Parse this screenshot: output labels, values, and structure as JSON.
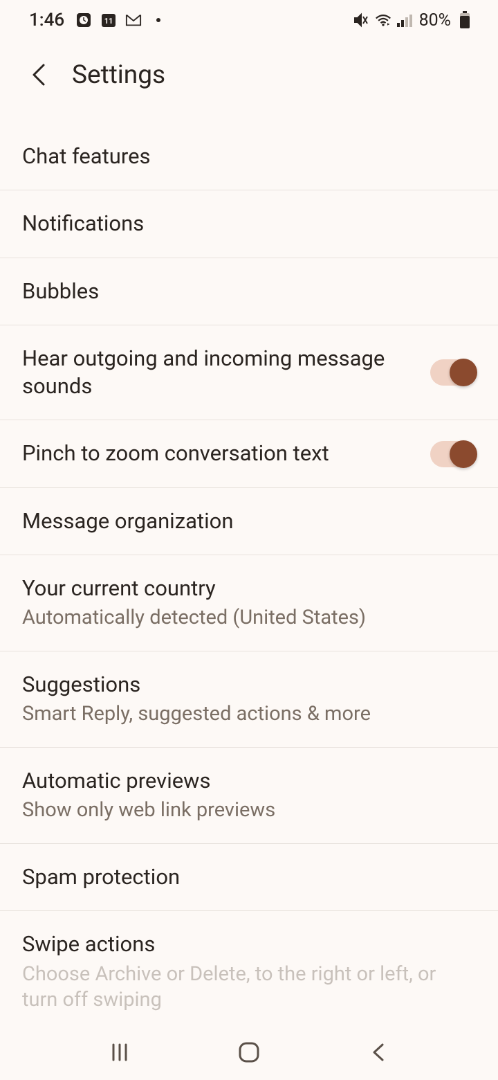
{
  "status": {
    "time": "1:46",
    "battery": "80%"
  },
  "header": {
    "title": "Settings"
  },
  "settings": {
    "items": [
      {
        "title": "Chat features",
        "subtitle": null,
        "toggle": null
      },
      {
        "title": "Notifications",
        "subtitle": null,
        "toggle": null
      },
      {
        "title": "Bubbles",
        "subtitle": null,
        "toggle": null
      },
      {
        "title": "Hear outgoing and incoming message sounds",
        "subtitle": null,
        "toggle": true
      },
      {
        "title": "Pinch to zoom conversation text",
        "subtitle": null,
        "toggle": true
      },
      {
        "title": "Message organization",
        "subtitle": null,
        "toggle": null
      },
      {
        "title": "Your current country",
        "subtitle": "Automatically detected (United States)",
        "toggle": null
      },
      {
        "title": "Suggestions",
        "subtitle": "Smart Reply, suggested actions & more",
        "toggle": null
      },
      {
        "title": "Automatic previews",
        "subtitle": "Show only web link previews",
        "toggle": null
      },
      {
        "title": "Spam protection",
        "subtitle": null,
        "toggle": null
      },
      {
        "title": "Swipe actions",
        "subtitle": "Choose Archive or Delete, to the right or left, or turn off swiping",
        "toggle": null
      }
    ]
  }
}
